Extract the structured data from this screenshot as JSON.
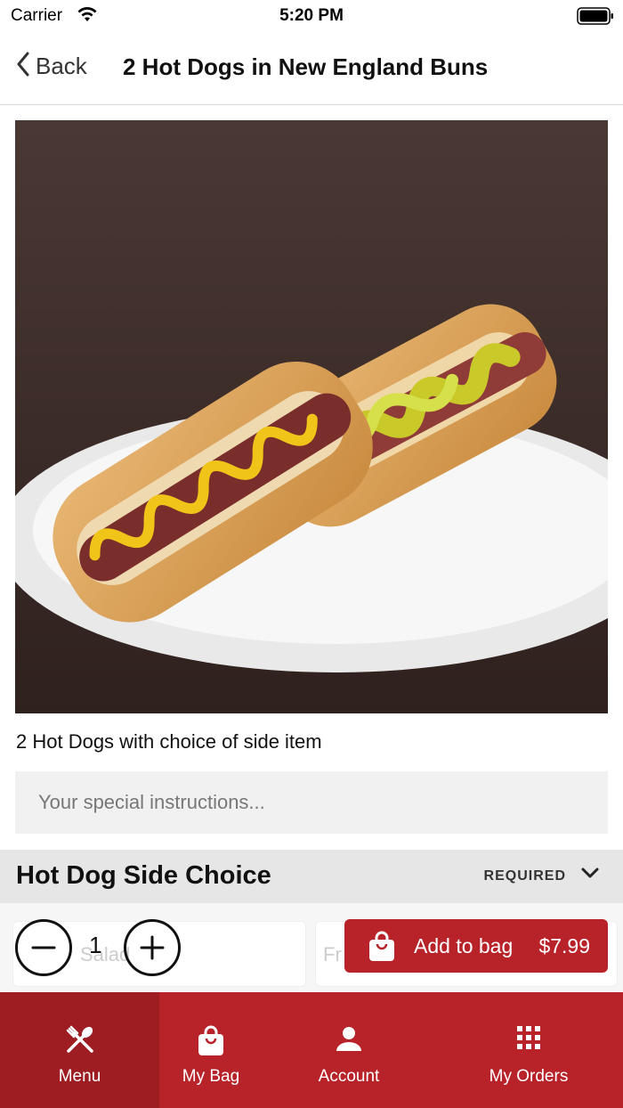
{
  "status_bar": {
    "carrier": "Carrier",
    "time": "5:20 PM"
  },
  "nav": {
    "back_label": "Back",
    "title": "2 Hot Dogs in New England Buns"
  },
  "item": {
    "description": "2 Hot Dogs with choice of side item",
    "instructions_placeholder": "Your special instructions..."
  },
  "side_choice": {
    "title": "Hot Dog Side Choice",
    "badge": "REQUIRED",
    "options": [
      {
        "label": "Salad"
      },
      {
        "label": "Fr"
      }
    ]
  },
  "order": {
    "quantity": "1",
    "add_label": "Add to bag",
    "price": "$7.99"
  },
  "tabbar": {
    "tabs": [
      {
        "label": "Menu",
        "icon": "utensils-icon",
        "active": true
      },
      {
        "label": "My Bag",
        "icon": "shopping-bag-icon",
        "active": false
      },
      {
        "label": "Account",
        "icon": "person-icon",
        "active": false
      },
      {
        "label": "My Orders",
        "icon": "grid-icon",
        "active": false
      }
    ]
  },
  "colors": {
    "brand": "#b8232a",
    "brand_dark": "#9d1d22",
    "section_bg": "#e6e6e6",
    "input_bg": "#f1f1f1"
  }
}
